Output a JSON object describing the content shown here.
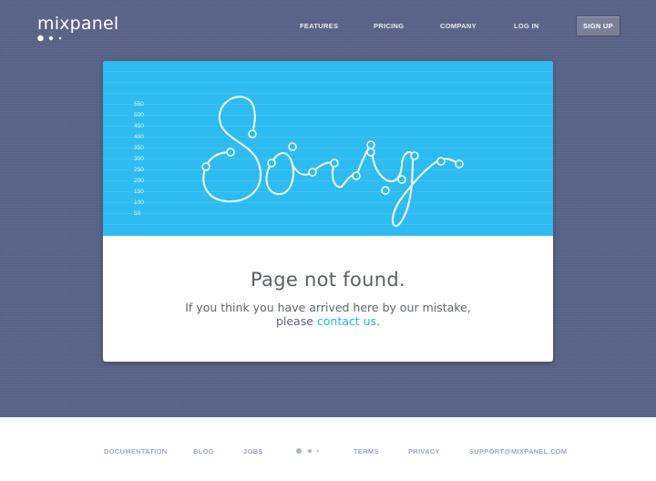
{
  "header": {
    "logo_text": "mixpanel",
    "nav": [
      "FEATURES",
      "PRICING",
      "COMPANY",
      "LOG IN"
    ],
    "signup_label": "SIGN UP"
  },
  "hero": {
    "word": "Sorry",
    "y_labels": [
      "550",
      "500",
      "450",
      "400",
      "350",
      "300",
      "250",
      "200",
      "150",
      "100",
      "50"
    ]
  },
  "message": {
    "title": "Page not found.",
    "line1": "If you think you have arrived here by our mistake,",
    "line2_prefix": "please ",
    "contact_link": "contact us",
    "line2_suffix": "."
  },
  "footer": {
    "links_left": [
      "DOCUMENTATION",
      "BLOG",
      "JOBS"
    ],
    "links_right": [
      "TERMS",
      "PRIVACY",
      "SUPPORT@MIXPANEL.COM"
    ]
  },
  "colors": {
    "background": "#5a6487",
    "hero": "#2cbcf1",
    "link": "#21b4ea"
  }
}
